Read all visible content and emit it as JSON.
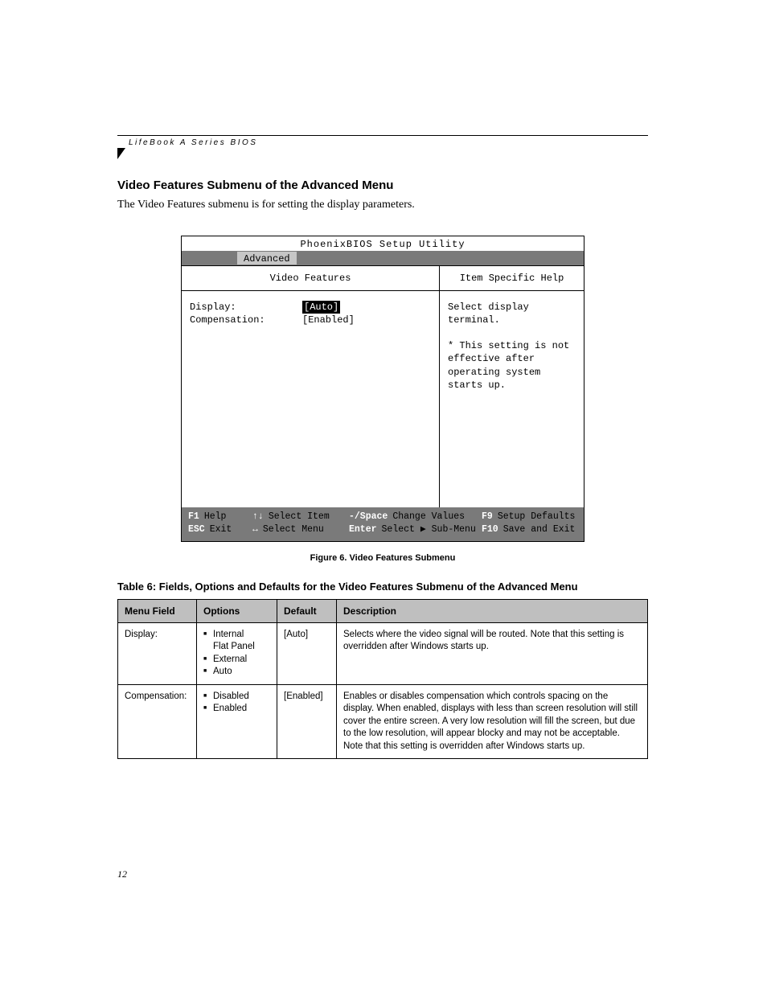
{
  "running_header": "LifeBook A Series BIOS",
  "section_heading": "Video Features Submenu of the Advanced Menu",
  "intro_paragraph": "The Video Features submenu is for setting the display parameters.",
  "bios": {
    "utility_title": "PhoenixBIOS Setup Utility",
    "active_tab": "Advanced",
    "left_panel_title": "Video Features",
    "right_panel_title": "Item Specific Help",
    "fields": [
      {
        "label": "Display:",
        "value": "[Auto]",
        "selected": true
      },
      {
        "label": "Compensation:",
        "value": "[Enabled]",
        "selected": false
      }
    ],
    "help_text": "Select display terminal.\n\n* This setting is not effective after operating system starts up.",
    "footer": {
      "row1": [
        {
          "key": "F1",
          "desc": "Help"
        },
        {
          "key": "↑↓",
          "desc": "Select Item"
        },
        {
          "key": "-/Space",
          "desc": "Change Values"
        },
        {
          "key": "F9",
          "desc": "Setup Defaults"
        }
      ],
      "row2": [
        {
          "key": "ESC",
          "desc": "Exit"
        },
        {
          "key": "↔",
          "desc": "Select Menu"
        },
        {
          "key": "Enter",
          "desc": "Select ▶ Sub-Menu"
        },
        {
          "key": "F10",
          "desc": "Save and Exit"
        }
      ]
    }
  },
  "figure_caption": "Figure 6.  Video Features Submenu",
  "table_caption": "Table 6: Fields, Options and Defaults for the Video Features Submenu of the Advanced Menu",
  "table": {
    "headers": [
      "Menu Field",
      "Options",
      "Default",
      "Description"
    ],
    "rows": [
      {
        "menu_field": "Display:",
        "options": [
          "Internal Flat Panel",
          "External",
          "Auto"
        ],
        "default": "[Auto]",
        "description": "Selects where the video signal will be routed. Note that this setting is overridden after Windows starts up."
      },
      {
        "menu_field": "Compensation:",
        "options": [
          "Disabled",
          "Enabled"
        ],
        "default": "[Enabled]",
        "description": "Enables or disables compensation which controls spacing on the display. When enabled, displays with less than screen resolution will still cover the entire screen. A very low resolution will fill the screen, but due to the low resolution, will appear blocky and may not be acceptable. Note that this setting is overridden after Windows starts up."
      }
    ]
  },
  "page_number": "12"
}
